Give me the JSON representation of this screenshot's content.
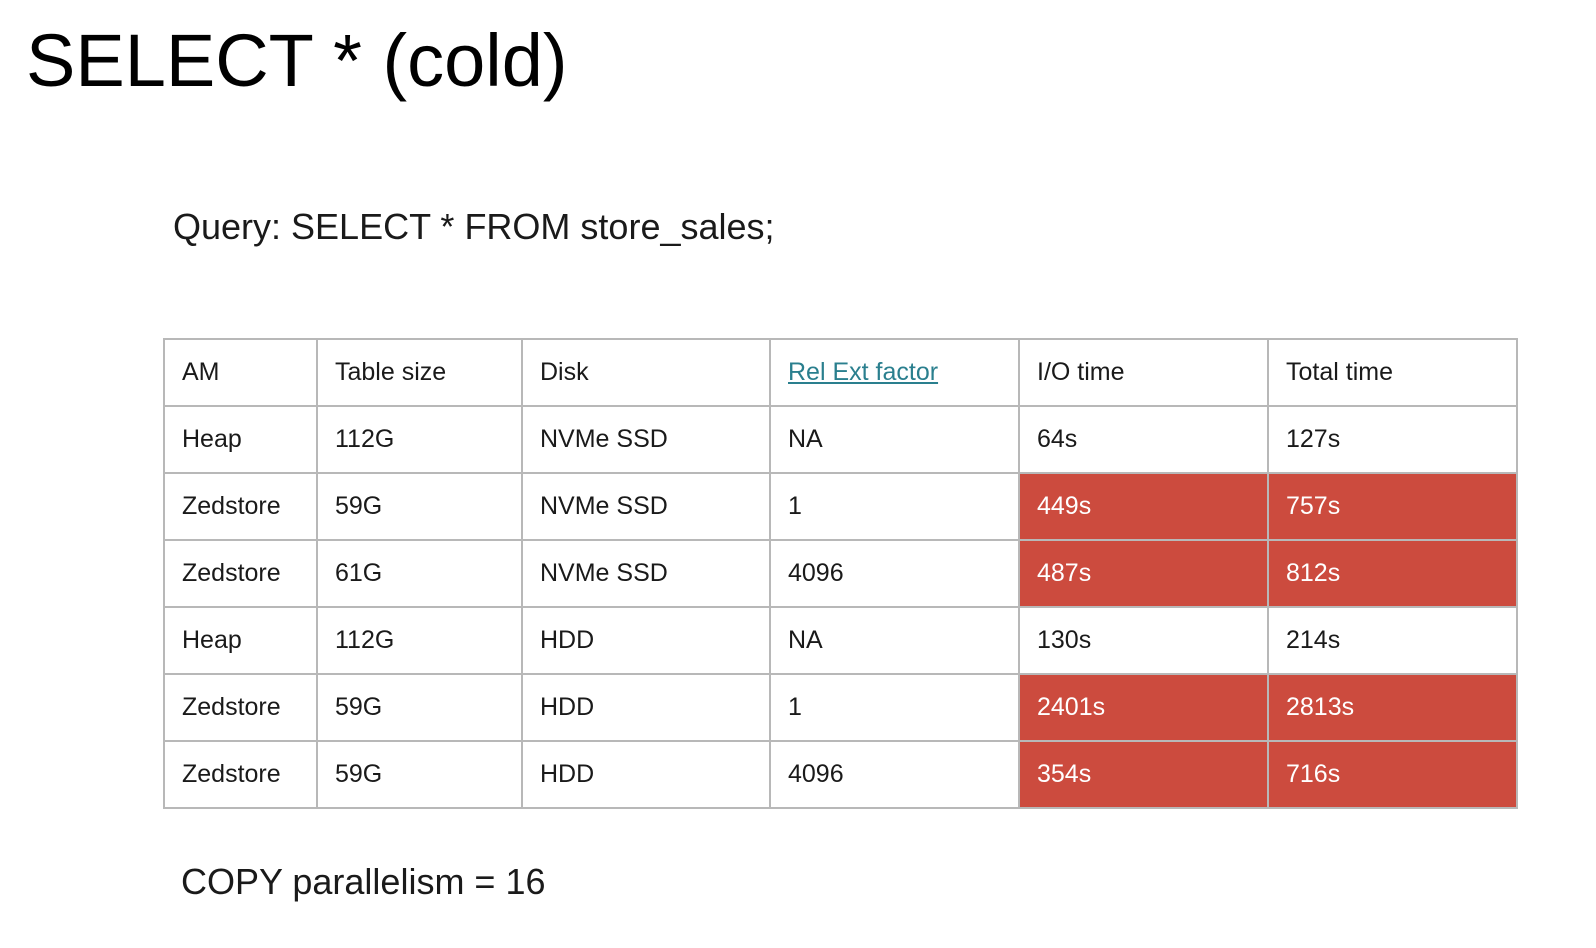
{
  "title": "SELECT * (cold)",
  "query": "Query: SELECT * FROM store_sales;",
  "highlight_color": "#cc4b3e",
  "link_color": "#2a7f8e",
  "table": {
    "headers": [
      "AM",
      "Table size",
      "Disk",
      "Rel Ext factor",
      "I/O time",
      "Total time"
    ],
    "rows": [
      {
        "am": "Heap",
        "table_size": "112G",
        "disk": "NVMe SSD",
        "rel_ext_factor": "NA",
        "io_time": "64s",
        "total_time": "127s",
        "highlighted": false
      },
      {
        "am": "Zedstore",
        "table_size": "59G",
        "disk": "NVMe SSD",
        "rel_ext_factor": "1",
        "io_time": "449s",
        "total_time": "757s",
        "highlighted": true
      },
      {
        "am": "Zedstore",
        "table_size": "61G",
        "disk": "NVMe SSD",
        "rel_ext_factor": "4096",
        "io_time": "487s",
        "total_time": "812s",
        "highlighted": true
      },
      {
        "am": "Heap",
        "table_size": "112G",
        "disk": "HDD",
        "rel_ext_factor": "NA",
        "io_time": "130s",
        "total_time": "214s",
        "highlighted": false
      },
      {
        "am": "Zedstore",
        "table_size": "59G",
        "disk": "HDD",
        "rel_ext_factor": "1",
        "io_time": "2401s",
        "total_time": "2813s",
        "highlighted": true
      },
      {
        "am": "Zedstore",
        "table_size": "59G",
        "disk": "HDD",
        "rel_ext_factor": "4096",
        "io_time": "354s",
        "total_time": "716s",
        "highlighted": true
      }
    ]
  },
  "footer": "COPY parallelism = 16"
}
